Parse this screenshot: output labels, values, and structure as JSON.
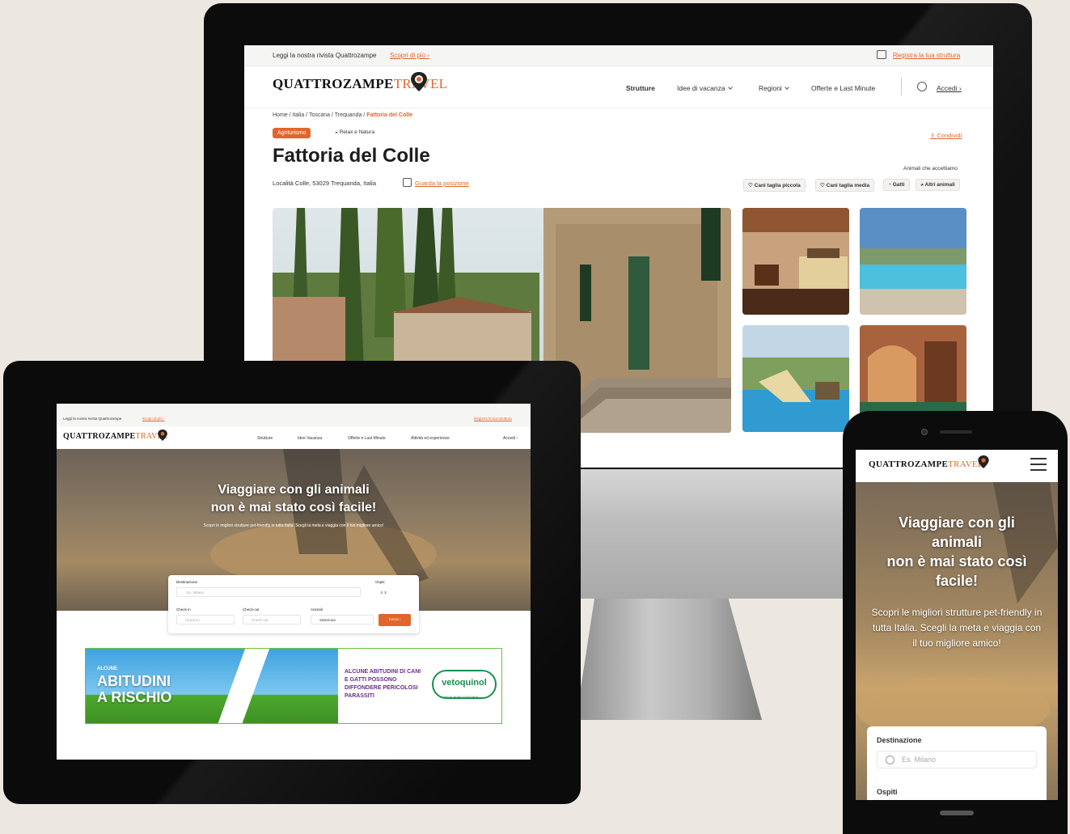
{
  "monitor": {
    "topbar": {
      "magazine_text": "Leggi la nostra rivista Quattrozampe",
      "magazine_link": "Scopri di più ›",
      "register_link": "Registra la tua struttura"
    },
    "logo": {
      "main": "QUATTROZAMPE",
      "accent": "TRAVEL"
    },
    "nav": {
      "items": [
        "Strutture",
        "Idee di vacanza",
        "Regioni",
        "Offerte e Last Minute"
      ],
      "login": "Accedi ›"
    },
    "breadcrumb": {
      "path": "Home / Italia / Toscana / Trequanda / ",
      "current": "Fattoria del Colle"
    },
    "tags": {
      "category": "Agriturismo",
      "theme": "Relax e Natura"
    },
    "share": "Condividi",
    "title": "Fattoria del Colle",
    "address": "Località Colle, 53029 Trequanda, Italia",
    "map_link": "Guarda la posizione",
    "animals": {
      "label": "Animali che accettiamo",
      "chips": [
        "Cani taglia piccola",
        "Cani taglia media",
        "Gatti",
        "Altri animali"
      ]
    }
  },
  "tablet": {
    "topbar": {
      "magazine_text": "Leggi la nostra rivista Quattrozampe",
      "magazine_link": "Scopri di più ›",
      "register_link": "Registra la tua struttura"
    },
    "logo": {
      "main": "QUATTROZAMPE",
      "accent": "TRAVEL"
    },
    "nav": {
      "items": [
        "Strutture",
        "Idee Vacanza",
        "Offerte e Last Minute",
        "Attività ed esperienze"
      ],
      "login": "Accedi ›"
    },
    "hero": {
      "title_line1": "Viaggiare con gli animali",
      "title_line2": "non è mai stato così facile!",
      "subtitle": "Scopri le migliori strutture pet-friendly in tutta Italia. Scegli la meta e viaggia con il tuo migliore amico!"
    },
    "search": {
      "destination_label": "Destinazione",
      "destination_placeholder": "Es. Milano",
      "guests_label": "Ospiti",
      "guests_value": "2",
      "checkin_label": "Check-in",
      "checkin_placeholder": "Check-in",
      "checkout_label": "Check-out",
      "checkout_placeholder": "Check-out",
      "animals_label": "Animali",
      "animals_placeholder": "Seleziona",
      "button": "Cerca ›"
    },
    "banner": {
      "headline_small": "ALCUNE",
      "headline_big1": "ABITUDINI",
      "headline_big2": "A RISCHIO",
      "body": "ALCUNE ABITUDINI DI CANI E GATTI POSSONO DIFFONDERE PERICOLOSI PARASSITI",
      "brand": "vetoquinol",
      "tagline": "ACHIEVE MORE TOGETHER"
    }
  },
  "phone": {
    "logo": {
      "main": "QUATTROZAMPE",
      "accent": "TRAVEL"
    },
    "hero": {
      "title_line1": "Viaggiare con gli",
      "title_line2": "animali",
      "title_line3": "non è mai stato così",
      "title_line4": "facile!",
      "subtitle": "Scopri le migliori strutture pet-friendly in tutta Italia. Scegli la meta e viaggia con il tuo migliore amico!"
    },
    "search": {
      "destination_label": "Destinazione",
      "destination_placeholder": "Es. Milano",
      "guests_label": "Ospiti"
    }
  },
  "colors": {
    "accent": "#e0662b",
    "bezel": "#0c0c0c",
    "background": "#ece8e1"
  }
}
